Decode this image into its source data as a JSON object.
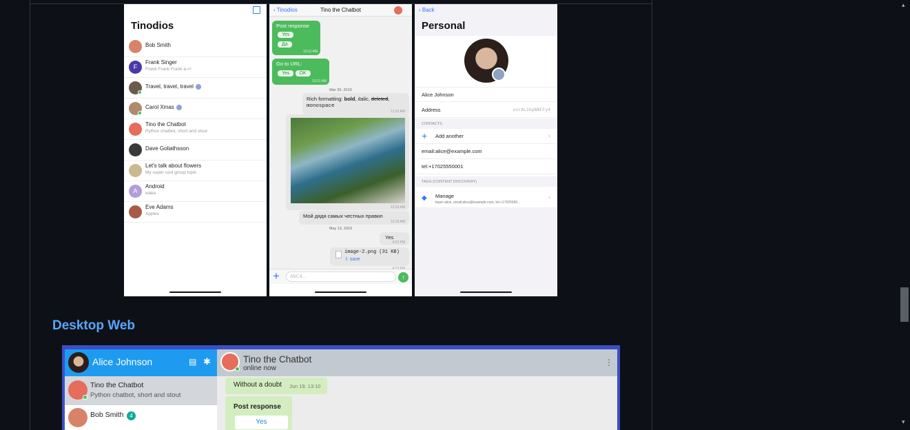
{
  "screenshots": {
    "chat_list": {
      "title": "Tinodios",
      "chats": [
        {
          "name": "Bob Smith",
          "subtitle": "",
          "color": "#d9826a",
          "letter": "",
          "badge": false,
          "online": false
        },
        {
          "name": "Frank Singer",
          "subtitle": "Frank Frank Frank a->!",
          "color": "#4a3aa8",
          "letter": "F",
          "badge": false,
          "online": false
        },
        {
          "name": "Travel, travel, travel",
          "subtitle": "",
          "color": "#6b5b4b",
          "letter": "",
          "badge": true,
          "online": true
        },
        {
          "name": "Carol Xmas",
          "subtitle": "",
          "color": "#b08a6a",
          "letter": "",
          "badge": true,
          "online": true
        },
        {
          "name": "Tino the Chatbot",
          "subtitle": "Python chatbot, short and stout",
          "color": "#e66c5c",
          "letter": "",
          "badge": false,
          "online": false
        },
        {
          "name": "Dave Goliathsson",
          "subtitle": "",
          "color": "#3a3a3a",
          "letter": "",
          "badge": false,
          "online": false
        },
        {
          "name": "Let's talk about flowers",
          "subtitle": "My super cool group topic",
          "color": "#c9b98f",
          "letter": "",
          "badge": false,
          "online": false
        },
        {
          "name": "Android",
          "subtitle": "waka",
          "color": "#b39ddb",
          "letter": "A",
          "badge": false,
          "online": false
        },
        {
          "name": "Eve Adams",
          "subtitle": "Apples",
          "color": "#a85a48",
          "letter": "",
          "badge": false,
          "online": false
        }
      ]
    },
    "chat": {
      "back_label": "Tinodios",
      "title": "Tino the Chatbot",
      "post_response": "Post response",
      "yes": "Yes",
      "da": "Да",
      "time1": "10:11 AM",
      "go_to_url": "Go to URL:",
      "ok": "OK",
      "time2": "10:11 AM",
      "date1": "Mar 30, 2019",
      "rich_prefix": "Rich formatting: ",
      "rich_bold": "bold",
      "rich_sep1": ", ",
      "rich_italic": "italic",
      "rich_sep2": ", ",
      "rich_deleted": "deleted",
      "rich_sep3": ",",
      "rich_mono": "monospace",
      "time3": "11:01 AM",
      "time4": "11:03 AM",
      "russian": "Мой дядя самых честных правил",
      "time5": "11:16 AM",
      "date2": "May 13, 2019",
      "yes_msg": "Yes",
      "time6": "4:22 PM",
      "file_name": "image-2.png (31 KB)",
      "save": "save",
      "time7": "4:23 PM",
      "input_placeholder": "AbCd..."
    },
    "profile": {
      "back_label": "Back",
      "title": "Personal",
      "name": "Alice Johnson",
      "address_label": "Address",
      "address_value": "usrAL1bpNNFFy4",
      "contacts_header": "Contacts",
      "add_another": "Add another",
      "email": "email:alice@example.com",
      "tel": "tel:+17025550001",
      "tags_header": "Tags (content discovery)",
      "manage": "Manage",
      "manage_sub": "basic:alice, email:alice@example.com, tel:+17025550..."
    }
  },
  "desktop": {
    "heading": "Desktop Web",
    "user_name": "Alice Johnson",
    "chats": [
      {
        "name": "Tino the Chatbot",
        "subtitle": "Python chatbot, short and stout",
        "badge": ""
      },
      {
        "name": "Bob Smith",
        "subtitle": "",
        "badge": "4"
      }
    ],
    "chat_title": "Tino the Chatbot",
    "chat_status": "online now",
    "msg1": "Without a doubt",
    "msg1_time": "Jun 19, 13:10",
    "msg2": "Post response",
    "msg2_button": "Yes"
  },
  "colors": {
    "page_bg": "#0d1117",
    "heading": "#58a6ff",
    "ios_blue": "#3478f6",
    "bubble_green": "#4cbb5c",
    "web_header": "#1e9bf0",
    "web_frame": "#3b4fc7"
  }
}
